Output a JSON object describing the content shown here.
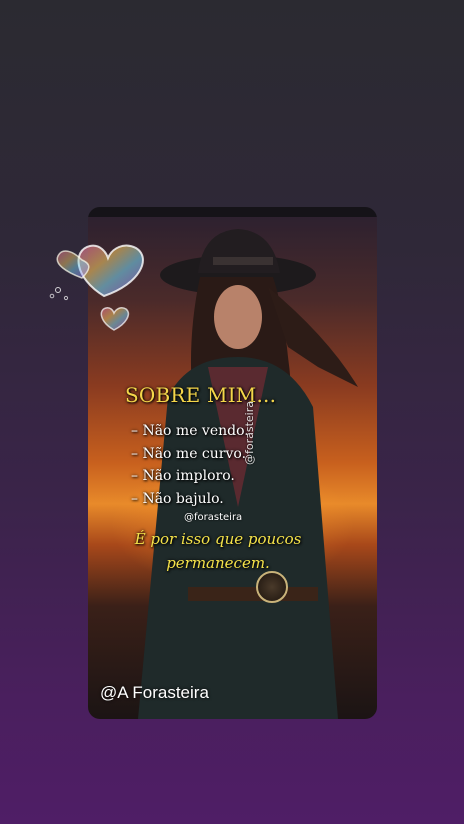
{
  "story": {
    "heading": "SOBRE MIM...",
    "lines": [
      "– Não me vendo.",
      "– Não me curvo.",
      "– Não imploro.",
      "– Não bajulo."
    ],
    "watermark_small": "@forasteira",
    "watermark_vertical": "@forasteira",
    "quote_line1": "É por isso que poucos",
    "quote_line2": "permanecem.",
    "handle": "@A Forasteira"
  },
  "colors": {
    "heading": "#f4d64a",
    "quote": "#f4e24a",
    "background_bottom": "#4f1e66"
  },
  "icons": {
    "hearts_sticker": "heart-bubbles-icon",
    "compass": "compass-icon"
  }
}
